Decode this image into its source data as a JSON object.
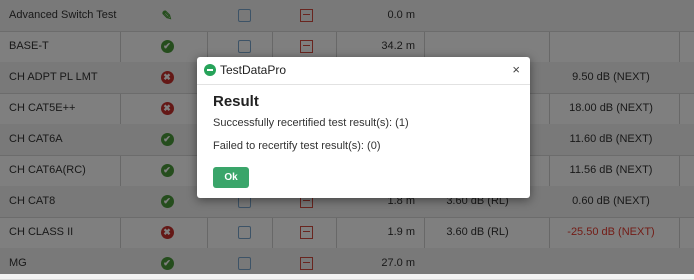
{
  "table": {
    "rows": [
      {
        "name": "Advanced Switch Test",
        "status": "warn",
        "length": "0.0 m",
        "rl": "",
        "next": "",
        "next_red": false
      },
      {
        "name": "BASE-T",
        "status": "ok",
        "length": "34.2 m",
        "rl": "",
        "next": "",
        "next_red": false
      },
      {
        "name": "CH ADPT PL LMT",
        "status": "fail",
        "length": "",
        "rl": "",
        "next": "9.50 dB (NEXT)",
        "next_red": false
      },
      {
        "name": "CH CAT5E++",
        "status": "fail",
        "length": "",
        "rl": "",
        "next": "18.00 dB (NEXT)",
        "next_red": false
      },
      {
        "name": "CH CAT6A",
        "status": "ok",
        "length": "",
        "rl": "",
        "next": "11.60 dB (NEXT)",
        "next_red": false
      },
      {
        "name": "CH CAT6A(RC)",
        "status": "ok",
        "length": "",
        "rl": "",
        "next": "11.56 dB (NEXT)",
        "next_red": false
      },
      {
        "name": "CH CAT8",
        "status": "ok",
        "length": "1.8 m",
        "rl": "3.60 dB (RL)",
        "next": "0.60 dB (NEXT)",
        "next_red": false
      },
      {
        "name": "CH CLASS II",
        "status": "fail",
        "length": "1.9 m",
        "rl": "3.60 dB (RL)",
        "next": "-25.50 dB (NEXT)",
        "next_red": true
      },
      {
        "name": "MG",
        "status": "ok",
        "length": "27.0 m",
        "rl": "",
        "next": "",
        "next_red": false
      }
    ],
    "status_icons": {
      "ok": "check-circle-icon",
      "fail": "x-circle-icon",
      "warn": "wrench-icon"
    }
  },
  "dialog": {
    "title": "TestDataPro",
    "close_label": "×",
    "heading": "Result",
    "success_line": "Successfully recertified test result(s): (1)",
    "failed_line": "Failed to recertify test result(s): (0)",
    "ok_label": "Ok"
  },
  "colors": {
    "ok_button": "#3aa56a",
    "fail": "#c9302c",
    "pass": "#4a9a3a",
    "next_red": "#e63a2e"
  }
}
